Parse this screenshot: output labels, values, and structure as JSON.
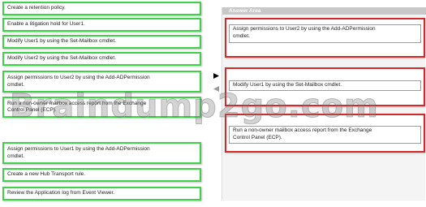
{
  "choices": [
    {
      "label": "Create a retention policy."
    },
    {
      "label": "Enable a litigation hold for User1."
    },
    {
      "label": "Modify User1 by using the Set-Mailbox cmdlet."
    },
    {
      "label": "Modify User2 by using the Set-Mailbox cmdlet."
    },
    {
      "label": "Assign permissions to User2 by using the Add-ADPermission\ncmdlet."
    },
    {
      "label": "Run a non-owner mailbox access report from the Exchange\nControl Panel (ECP)."
    },
    {
      "label": "Assign permissions to User1 by using the Add-ADPermission\ncmdlet."
    },
    {
      "label": "Create a new Hub Transport rule."
    },
    {
      "label": "Review the Application log from Event Viewer."
    }
  ],
  "answer_area": {
    "title": "Answer Area",
    "slots": [
      {
        "label": "Assign permissions to User2 by using the Add-ADPermission\ncmdlet."
      },
      {
        "label": "Modify User1 by using the Set-Mailbox cmdlet."
      },
      {
        "label": "Run a non-owner mailbox access report from the Exchange\nControl Panel (ECP)."
      }
    ]
  },
  "controls": {
    "add_arrow_icon": "arrow-right-icon",
    "remove_arrow_icon": "arrow-left-icon"
  },
  "watermark": {
    "text": "Braindump2go.com"
  },
  "colors": {
    "choice_border": "#3fd14a",
    "slot_border": "#d22a2a",
    "header_bg": "#c8c8c8"
  }
}
